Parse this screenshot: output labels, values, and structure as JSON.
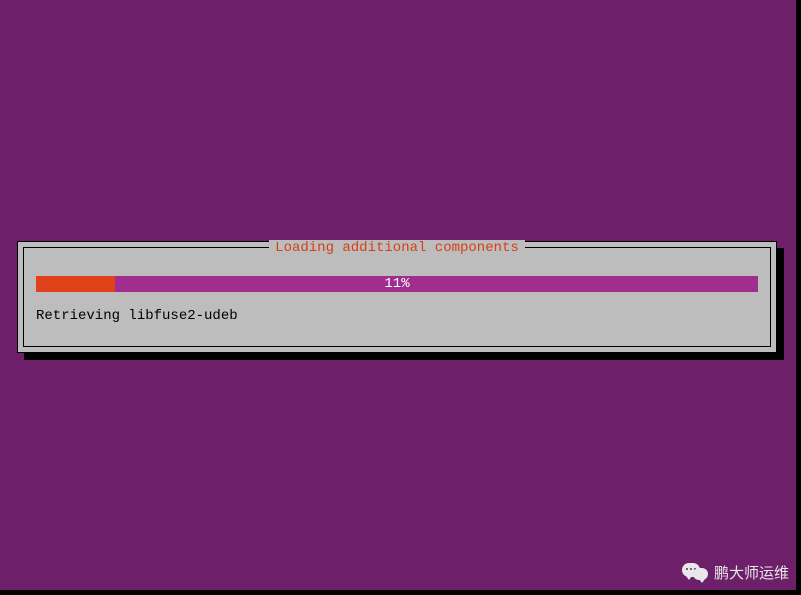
{
  "dialog": {
    "title": "Loading additional components",
    "progress_percent": 11,
    "progress_label": "11%",
    "status_text": "Retrieving libfuse2-udeb"
  },
  "watermark": {
    "text": "鹏大师运维"
  },
  "colors": {
    "background": "#6d2069",
    "dialog_bg": "#bdbdbd",
    "title": "#d63f18",
    "progress_bg": "#9f2e8f",
    "progress_fill": "#e04118"
  }
}
